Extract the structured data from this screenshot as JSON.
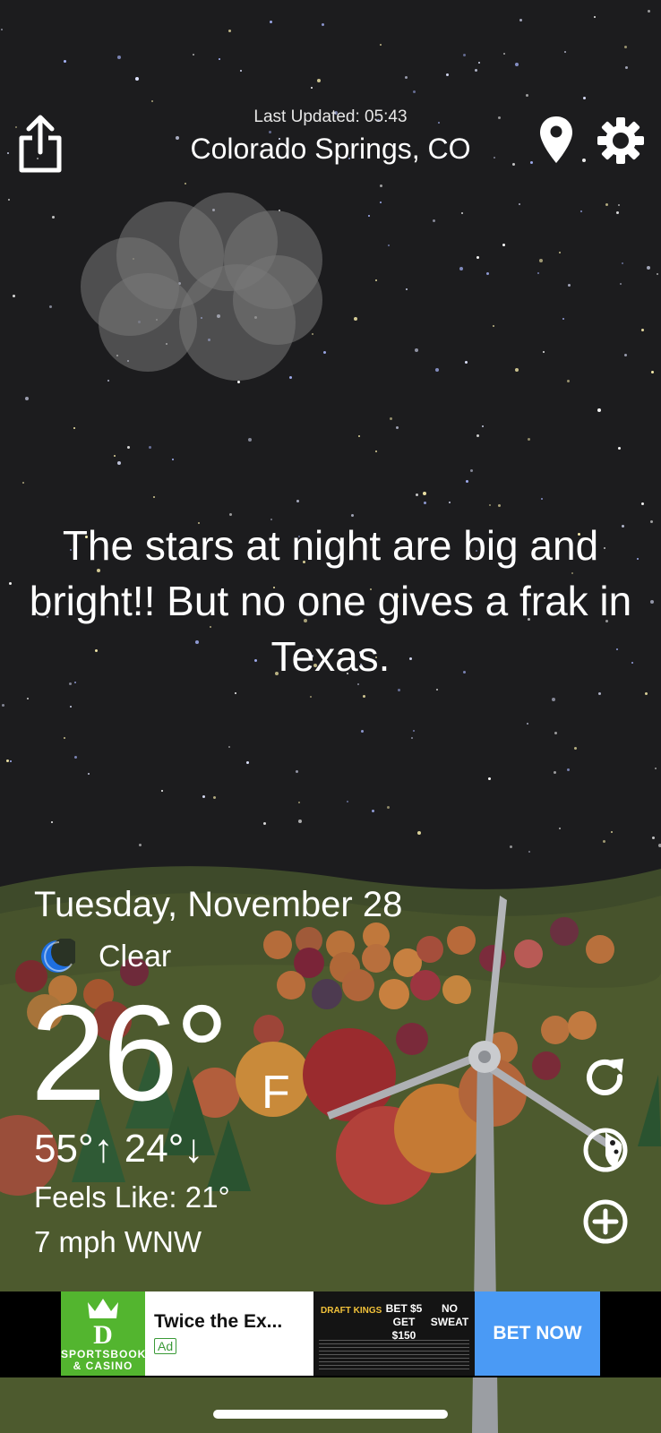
{
  "header": {
    "last_updated": "Last Updated: 05:43",
    "location": "Colorado Springs, CO"
  },
  "icons": {
    "share": "share-icon",
    "location": "location-pin-icon",
    "settings": "gear-icon",
    "condition": "moon-icon",
    "refresh": "refresh-icon",
    "radar": "radar-icon",
    "add": "add-location-icon"
  },
  "message": "The stars at night are big and bright!! But no one gives a frak in Texas.",
  "weather": {
    "date": "Tuesday, November 28",
    "condition": "Clear",
    "temperature": "26°",
    "unit": "F",
    "high_low": "55°↑ 24°↓",
    "feels_like": "Feels Like: 21°",
    "wind": "7 mph WNW"
  },
  "ad": {
    "brand": "SPORTSBOOK & CASINO",
    "title": "Twice the Ex...",
    "tag": "Ad",
    "creative_logo": "DRAFT KINGS",
    "creative_offer_a": "BET $5 GET $150",
    "creative_offer_b": "NO SWEAT",
    "cta": "BET NOW"
  },
  "colors": {
    "sky": "#1c1c1e",
    "ad_brand_green": "#53b52f",
    "ad_cta_blue": "#4a9af5",
    "moon_blue": "#1e6fe0"
  }
}
